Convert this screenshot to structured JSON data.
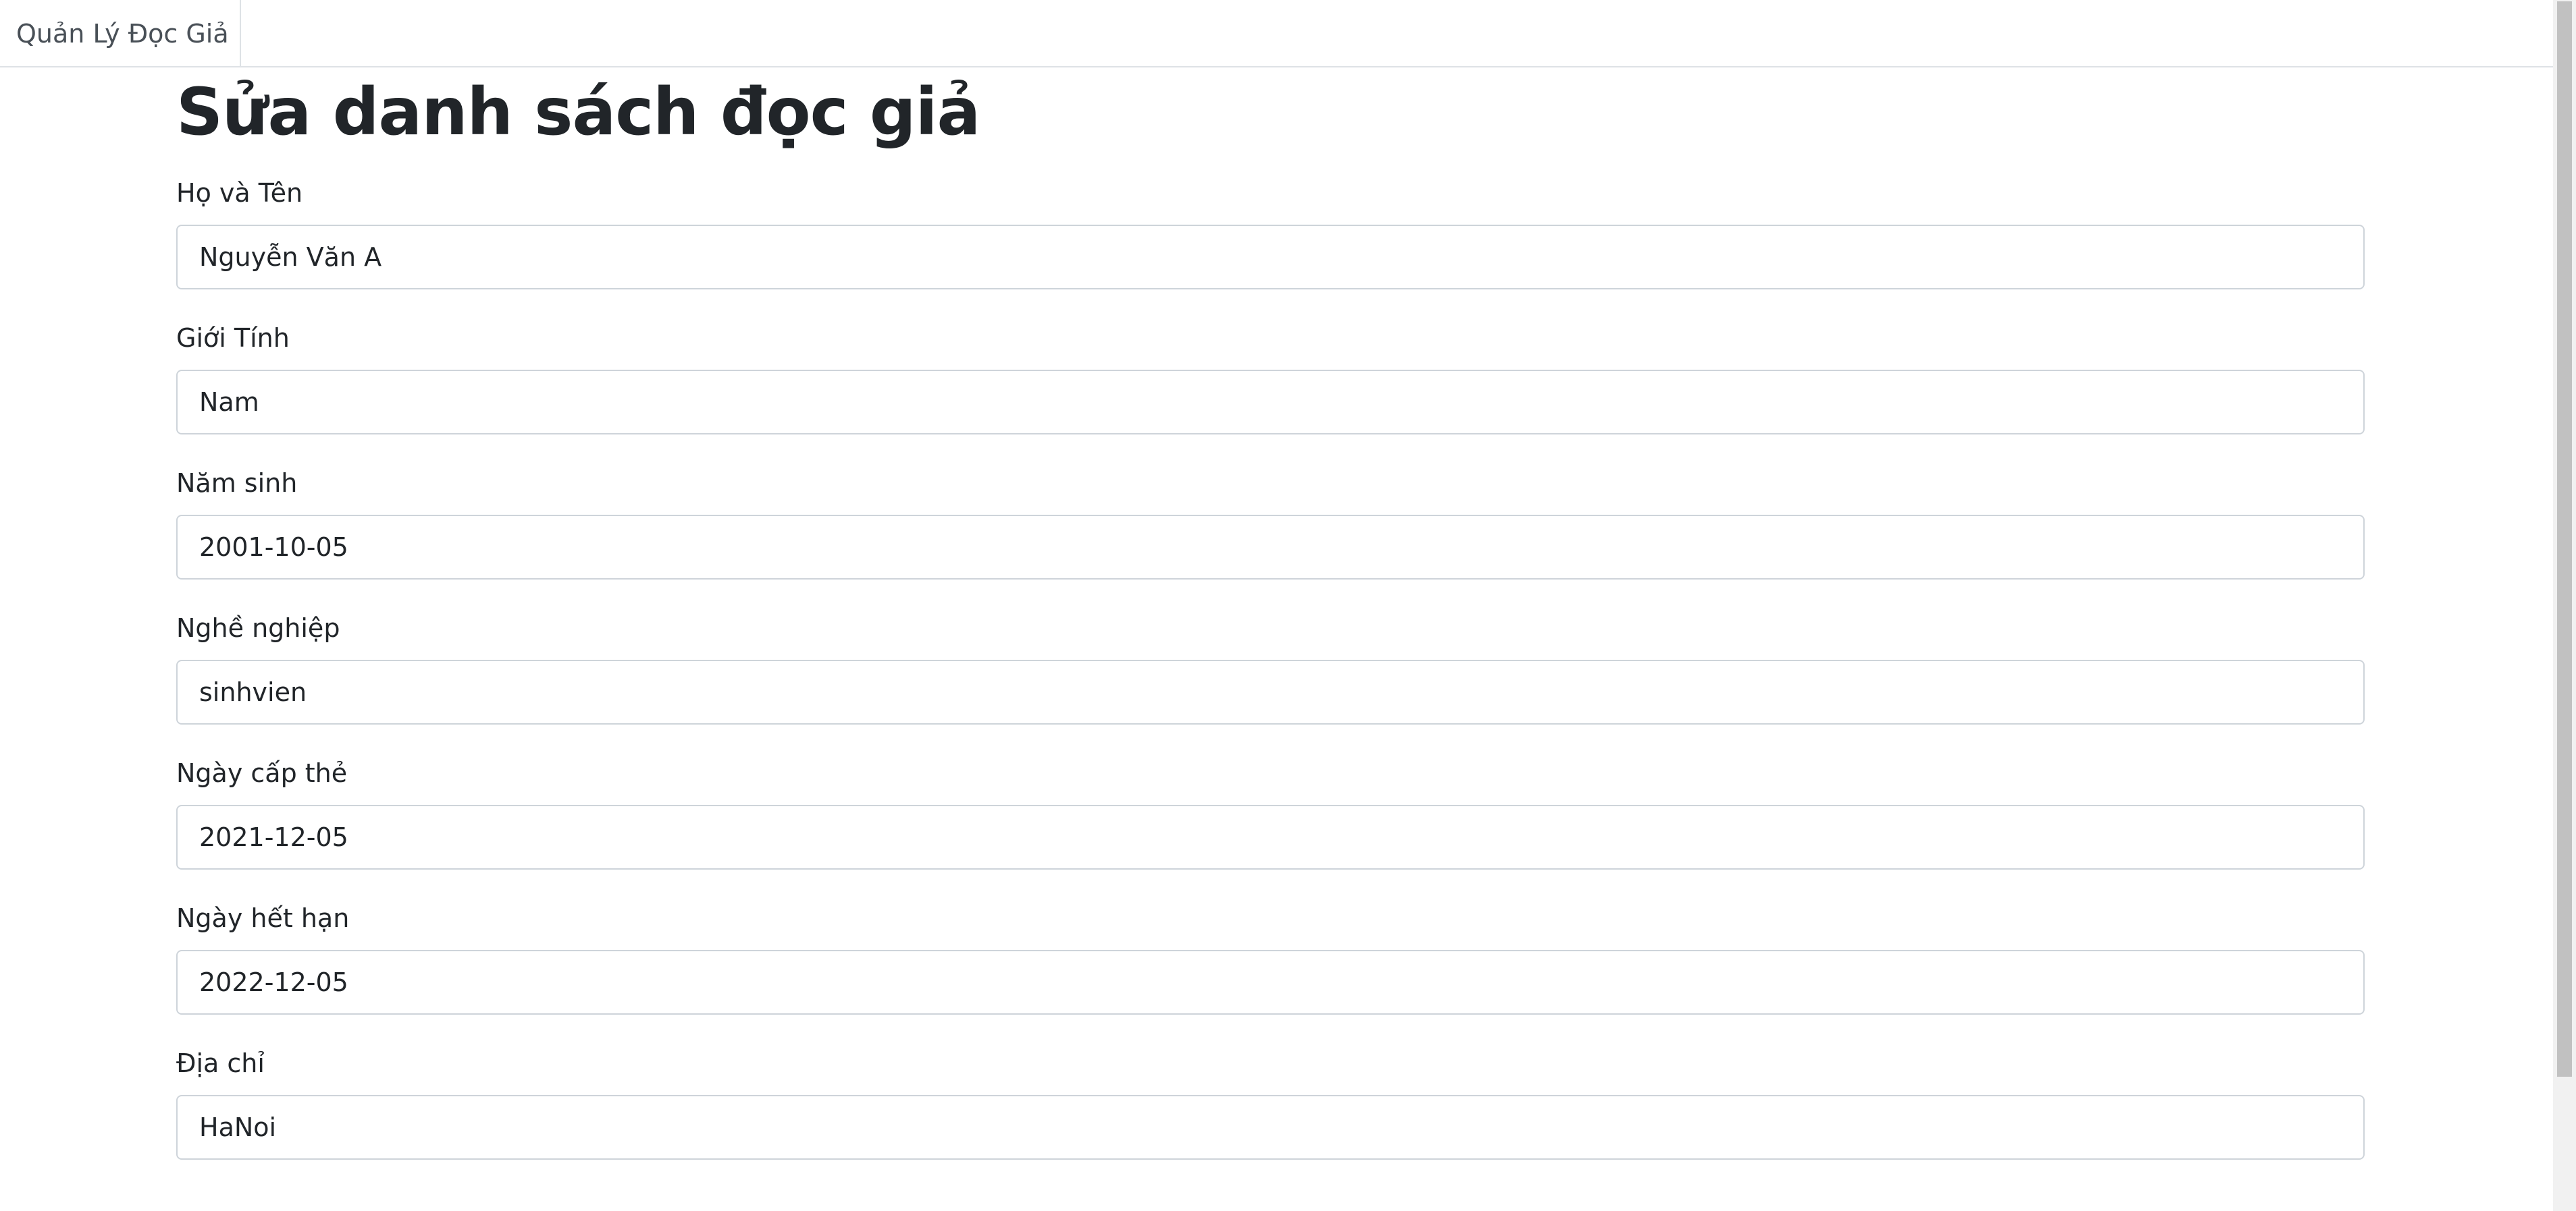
{
  "nav": {
    "brand": "Quản Lý Đọc Giả"
  },
  "page": {
    "title": "Sửa danh sách đọc giả"
  },
  "form": {
    "fields": [
      {
        "label": "Họ và Tên",
        "value": "Nguyễn Văn A"
      },
      {
        "label": "Giới Tính",
        "value": "Nam"
      },
      {
        "label": "Năm sinh",
        "value": "2001-10-05"
      },
      {
        "label": "Nghề nghiệp",
        "value": "sinhvien"
      },
      {
        "label": "Ngày cấp thẻ",
        "value": "2021-12-05"
      },
      {
        "label": "Ngày hết hạn",
        "value": "2022-12-05"
      },
      {
        "label": "Địa chỉ",
        "value": "HaNoi"
      }
    ]
  },
  "colors": {
    "text": "#212529",
    "border": "#ced4da",
    "divider": "#dee2e6",
    "scrollbar_track": "#f1f1f1",
    "scrollbar_thumb": "#c1c1c1"
  }
}
